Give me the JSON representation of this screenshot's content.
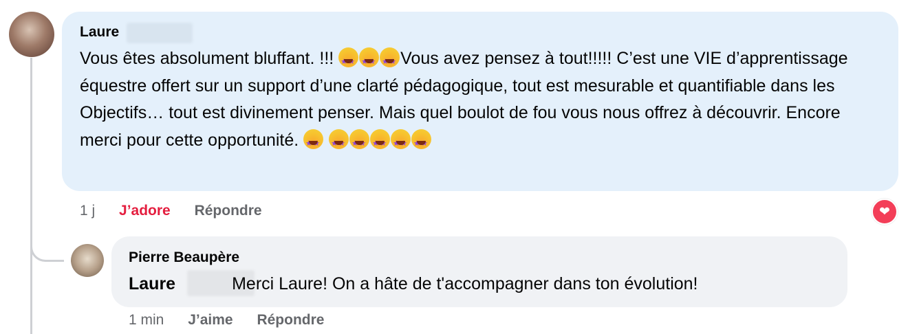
{
  "comment": {
    "author": "Laure",
    "text_parts": [
      "Vous êtes absolument bluffant. !!! ",
      "Vous avez pensez à tout!!!!! C’est une VIE d’apprentissage équestre offert sur un support d’une clarté pédagogique, tout est mesurable et quantifiable dans les Objectifs… tout est divinement penser. Mais quel boulot de fou vous nous offrez à découvrir. Encore merci pour cette opportunité. "
    ],
    "emoji_name": "star-struck-emoji",
    "time": "1 j",
    "like_label": "J’adore",
    "reply_label": "Répondre",
    "reaction": "love"
  },
  "reply": {
    "author": "Pierre Beaupère",
    "mention": "Laure",
    "text": "Merci Laure! On a hâte de t'accompagner dans ton évolution!",
    "time": "1 min",
    "like_label": "J’aime",
    "reply_label": "Répondre"
  },
  "colors": {
    "comment_bubble": "#e4f0fb",
    "reply_bubble": "#f0f2f5",
    "love_red": "#e41e3f",
    "muted": "#65676b"
  }
}
